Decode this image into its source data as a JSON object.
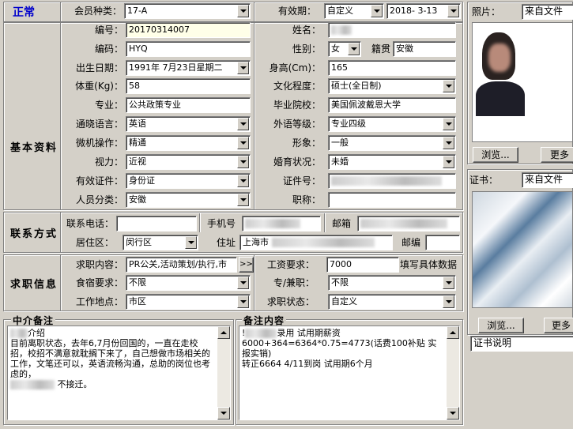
{
  "header": {
    "status": "正常",
    "member_type_label": "会员种类：",
    "member_type_value": "17-A",
    "validity_label": "有效期：",
    "validity_value": "自定义",
    "date_value": "2018- 3-13",
    "photo_label": "照片：",
    "photo_source": "来自文件"
  },
  "basic": {
    "section_title": "基本资料",
    "id_label": "编号：",
    "id_value": "20170314007",
    "name_label": "姓名：",
    "code_label": "编码：",
    "code_value": "HYQ",
    "gender_label": "性别：",
    "gender_value": "女",
    "origin_label": "籍贯",
    "origin_value": "安徽",
    "birth_label": "出生日期：",
    "birth_value": "1991年 7月23日星期二",
    "height_label": "身高(Cm)：",
    "height_value": "165",
    "weight_label": "体重(Kg)：",
    "weight_value": "58",
    "education_label": "文化程度：",
    "education_value": "硕士(全日制)",
    "major_label": "专业：",
    "major_value": "公共政策专业",
    "school_label": "毕业院校：",
    "school_value": "美国佩波戴恩大学",
    "language_label": "通晓语言：",
    "language_value": "英语",
    "foreign_label": "外语等级：",
    "foreign_value": "专业四级",
    "computer_label": "微机操作：",
    "computer_value": "精通",
    "image_label": "形象：",
    "image_value": "一般",
    "vision_label": "视力：",
    "vision_value": "近视",
    "marital_label": "婚育状况：",
    "marital_value": "未婚",
    "cert_label": "有效证件：",
    "cert_value": "身份证",
    "cert_no_label": "证件号：",
    "category_label": "人员分类：",
    "category_value": "安徽",
    "title_label": "职称："
  },
  "contact": {
    "section_title": "联系方式",
    "phone_label": "联系电话：",
    "mobile_label": "手机号",
    "email_label": "邮箱",
    "district_label": "居住区：",
    "district_value": "闵行区",
    "address_label": "住址",
    "address_value": "上海市",
    "postcode_label": "邮编"
  },
  "job": {
    "section_title": "求职信息",
    "content_label": "求职内容：",
    "content_value": "PR公关,活动策划/执行,市",
    "more_btn": ">>",
    "salary_label": "工资要求：",
    "salary_value": "7000",
    "salary_hint": "填写具体数据",
    "board_label": "食宿要求：",
    "board_value": "不限",
    "parttime_label": "专/兼职：",
    "parttime_value": "不限",
    "location_label": "工作地点：",
    "location_value": "市区",
    "status_label": "求职状态：",
    "status_value": "自定义"
  },
  "notes": {
    "agency_title": "中介备注",
    "agency_lines": [
      "介绍",
      "目前离职状态，去年6,7月份回国的，一直在走校招，校招不满意就耽搁下来了，自己想做市场相关的工作，文笔还可以，英语流畅沟通，总助的岗位也考虑的，",
      "不接迁。"
    ],
    "remark_title": "备注内容",
    "remark_lines": [
      "录用 试用期薪资",
      "6000+364=6364*0.75=4773(话费100补贴 实报实销)",
      "转正6664 4/11到岗  试用期6个月"
    ]
  },
  "side": {
    "browse_btn": "浏览...",
    "more_btn": "更多",
    "cert_label": "证书：",
    "cert_source": "来自文件",
    "browse_btn2": "浏览...",
    "more_btn2": "更多",
    "cert_desc": "证书说明"
  },
  "colors": {
    "status": "#0000cc",
    "panel": "#d4d0c8",
    "field_highlight": "#ffffe8"
  }
}
